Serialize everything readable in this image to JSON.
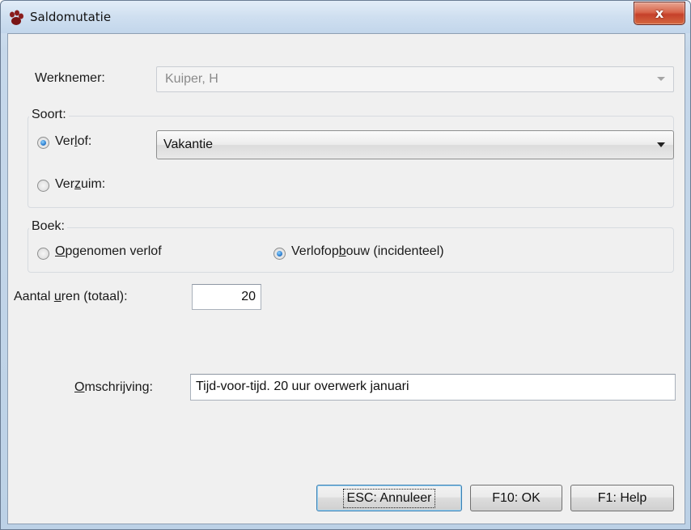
{
  "window": {
    "title": "Saldomutatie",
    "close_label": "x"
  },
  "form": {
    "werknemer_label": "Werknemer:",
    "werknemer_value": "Kuiper, H",
    "soort": {
      "group_label": "Soort:",
      "verlof_pre": "Ver",
      "verlof_ul": "l",
      "verlof_post": "of:",
      "verlof_checked": true,
      "verlof_type_value": "Vakantie",
      "verzuim_pre": "Ver",
      "verzuim_ul": "z",
      "verzuim_post": "uim:",
      "verzuim_checked": false
    },
    "boek": {
      "group_label": "Boek:",
      "opgenomen_ul": "O",
      "opgenomen_post": "pgenomen verlof",
      "opgenomen_checked": false,
      "verlofopbouw_pre": "Verlofop",
      "verlofopbouw_ul": "b",
      "verlofopbouw_post": "ouw (incidenteel)",
      "verlofopbouw_checked": true
    },
    "aantal_pre": "Aantal ",
    "aantal_ul": "u",
    "aantal_post": "ren (totaal):",
    "aantal_value": "20",
    "omschrijving_ul": "O",
    "omschrijving_post": "mschrijving:",
    "omschrijving_value": "Tijd-voor-tijd. 20 uur overwerk januari"
  },
  "buttons": {
    "cancel": "ESC: Annuleer",
    "ok": "F10: OK",
    "help": "F1: Help"
  },
  "icons": {
    "app": "app-paw-icon",
    "close": "close-icon",
    "dropdown": "chevron-down-icon"
  },
  "colors": {
    "accent_radio": "#2f7fcf",
    "close_button": "#c5402a",
    "default_button_border": "#3c7fb1"
  }
}
